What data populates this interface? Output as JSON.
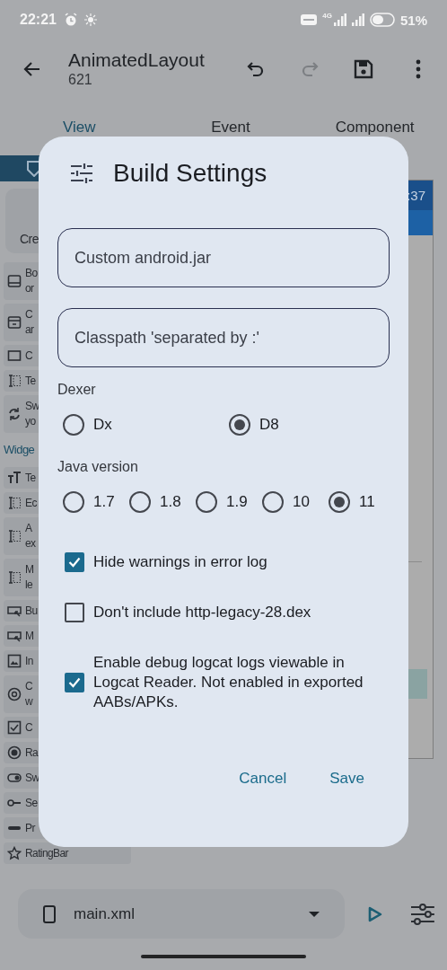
{
  "status_bar": {
    "time": "22:21",
    "network": "4G",
    "battery": "51%"
  },
  "app_bar": {
    "title": "AnimatedLayout",
    "subtitle": "621",
    "redo_disabled": true
  },
  "tabs": [
    {
      "label": "View",
      "selected": true
    },
    {
      "label": "Event",
      "selected": false
    },
    {
      "label": "Component",
      "selected": false
    }
  ],
  "palette": {
    "card": "Cre",
    "items": [
      {
        "kind": "item",
        "text": "Bo\nor"
      },
      {
        "kind": "item",
        "text": "C\nar"
      },
      {
        "kind": "item",
        "text": "C"
      },
      {
        "kind": "item",
        "text": "Te"
      },
      {
        "kind": "item",
        "text": "Sw\nyo"
      },
      {
        "kind": "section",
        "text": "Widge"
      },
      {
        "kind": "item",
        "text": "Te"
      },
      {
        "kind": "item",
        "text": "Ec"
      },
      {
        "kind": "item",
        "text": "A\nex"
      },
      {
        "kind": "item",
        "text": "M\nle"
      },
      {
        "kind": "item",
        "text": "Bu"
      },
      {
        "kind": "item",
        "text": "M"
      },
      {
        "kind": "item",
        "text": "In"
      },
      {
        "kind": "item",
        "text": "C\nw"
      },
      {
        "kind": "item",
        "text": "C"
      },
      {
        "kind": "item",
        "text": "Ra"
      },
      {
        "kind": "item",
        "text": "Sw"
      },
      {
        "kind": "item",
        "text": "Se"
      },
      {
        "kind": "item",
        "text": "Pr"
      },
      {
        "kind": "item",
        "text": "RatingBar"
      }
    ]
  },
  "canvas": {
    "header": ":37"
  },
  "dialog": {
    "title": "Build Settings",
    "fields": [
      {
        "placeholder": "Custom android.jar"
      },
      {
        "placeholder": "Classpath 'separated by :'"
      }
    ],
    "dexer": {
      "label": "Dexer",
      "options": [
        {
          "label": "Dx",
          "selected": false
        },
        {
          "label": "D8",
          "selected": true
        }
      ]
    },
    "java": {
      "label": "Java version",
      "options": [
        {
          "label": "1.7",
          "selected": false
        },
        {
          "label": "1.8",
          "selected": false
        },
        {
          "label": "1.9",
          "selected": false
        },
        {
          "label": "10",
          "selected": false
        },
        {
          "label": "11",
          "selected": true
        }
      ]
    },
    "checks": [
      {
        "label": "Hide warnings in error log",
        "checked": true
      },
      {
        "label": "Don't include http-legacy-28.dex",
        "checked": false
      },
      {
        "label": "Enable debug logcat logs viewable in Logcat Reader. Not enabled in exported AABs/APKs.",
        "checked": true
      }
    ],
    "buttons": [
      "Cancel",
      "Save"
    ]
  },
  "bottom_bar": {
    "file": "main.xml"
  }
}
